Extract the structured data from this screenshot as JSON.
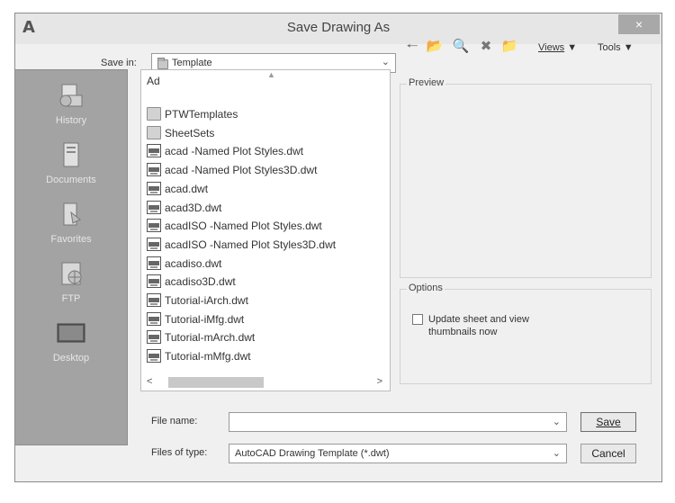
{
  "window": {
    "title": "Save Drawing As",
    "app_icon": "A",
    "close_glyph": "×"
  },
  "toolbar": {
    "save_in_label": "Save in:",
    "save_in_value": "Template",
    "icons": [
      "back-arrow-icon",
      "up-folder-icon",
      "search-web-icon",
      "delete-icon",
      "new-folder-icon"
    ],
    "views_label": "Views",
    "tools_label": "Tools"
  },
  "places": [
    {
      "label": "History",
      "icon": "history-icon"
    },
    {
      "label": "Documents",
      "icon": "documents-icon"
    },
    {
      "label": "Favorites",
      "icon": "favorites-icon"
    },
    {
      "label": "FTP",
      "icon": "ftp-icon"
    },
    {
      "label": "Desktop",
      "icon": "desktop-icon"
    }
  ],
  "file_list": {
    "column_header": "Ad",
    "items": [
      {
        "name": "PTWTemplates",
        "type": "folder"
      },
      {
        "name": "SheetSets",
        "type": "folder"
      },
      {
        "name": "acad -Named Plot Styles.dwt",
        "type": "dwt"
      },
      {
        "name": "acad -Named Plot Styles3D.dwt",
        "type": "dwt"
      },
      {
        "name": "acad.dwt",
        "type": "dwt"
      },
      {
        "name": "acad3D.dwt",
        "type": "dwt"
      },
      {
        "name": "acadISO -Named Plot Styles.dwt",
        "type": "dwt"
      },
      {
        "name": "acadISO -Named Plot Styles3D.dwt",
        "type": "dwt"
      },
      {
        "name": "acadiso.dwt",
        "type": "dwt"
      },
      {
        "name": "acadiso3D.dwt",
        "type": "dwt"
      },
      {
        "name": "Tutorial-iArch.dwt",
        "type": "dwt"
      },
      {
        "name": "Tutorial-iMfg.dwt",
        "type": "dwt"
      },
      {
        "name": "Tutorial-mArch.dwt",
        "type": "dwt"
      },
      {
        "name": "Tutorial-mMfg.dwt",
        "type": "dwt"
      }
    ]
  },
  "preview": {
    "label": "Preview"
  },
  "options": {
    "label": "Options",
    "checkbox_label": "Update sheet and view thumbnails now",
    "checked": false
  },
  "file_name": {
    "label": "File name:",
    "value": ""
  },
  "file_type": {
    "label": "Files of type:",
    "value": "AutoCAD Drawing Template (*.dwt)"
  },
  "buttons": {
    "save": "Save",
    "cancel": "Cancel"
  }
}
